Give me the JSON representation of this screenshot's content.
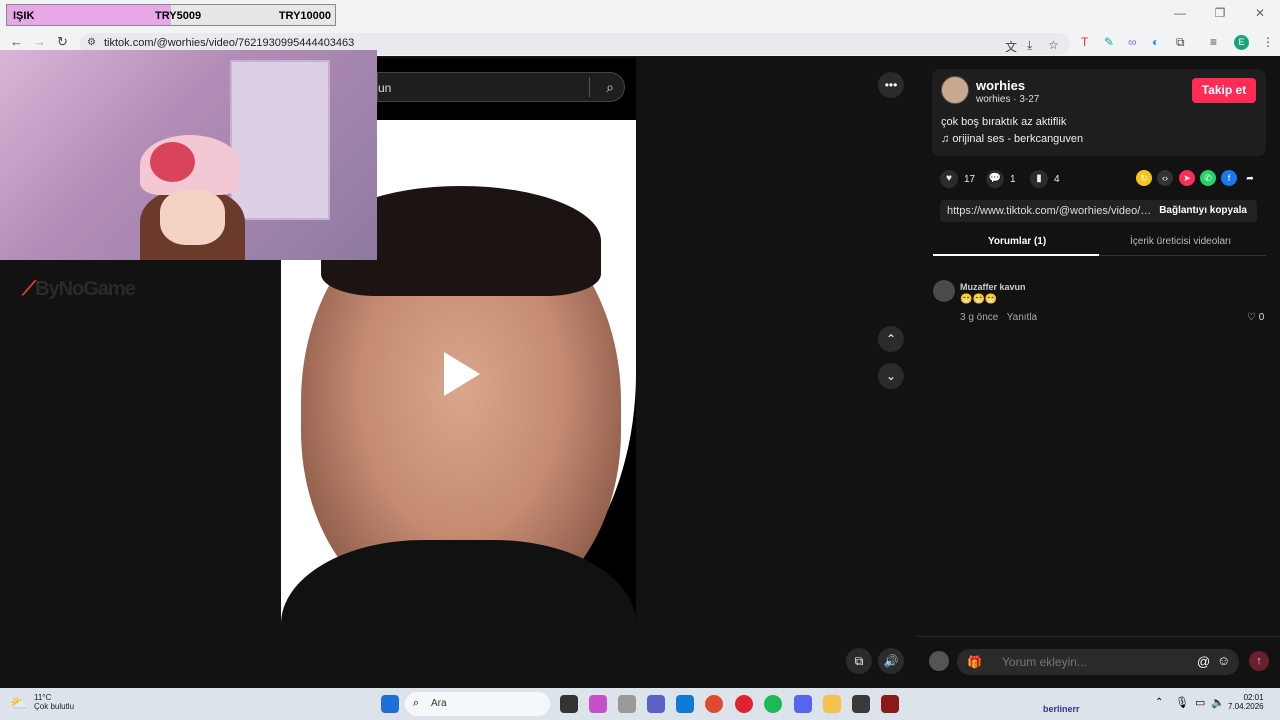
{
  "overlay": {
    "donation_name": "IŞIK",
    "donation_current": "TRY5009",
    "donation_goal": "TRY10000",
    "donation_progress_pct": 50.09
  },
  "browser": {
    "url": "tiktok.com/@worhies/video/7621930995444403463",
    "profile_initial": "E"
  },
  "stream_logo": "ByNoGame",
  "video": {
    "search_text": "un"
  },
  "post": {
    "username": "worhies",
    "subtitle": "worhies · 3-27",
    "follow_label": "Takip et",
    "description": "çok boş bıraktık az aktiflik",
    "music": "orijinal ses - berkcanguven",
    "likes": "17",
    "comments": "1",
    "saves": "4",
    "link": "https://www.tiktok.com/@worhies/video/7621...",
    "copy_label": "Bağlantıyı kopyala"
  },
  "tabs": {
    "comments": "Yorumlar (1)",
    "creator_videos": "İçerik üreticisi videoları"
  },
  "comment": {
    "author": "Muzaffer kavun",
    "text": "😁😁😁",
    "time": "3 g önce",
    "reply": "Yanıtla",
    "likes": "0"
  },
  "comment_input": {
    "placeholder": "Yorum ekleyin..."
  },
  "taskbar": {
    "temp": "11°C",
    "weather": "Çok bulutlu",
    "search": "Ara",
    "time": "02:01",
    "date": "7.04.2026",
    "notice_user": "berlinerr"
  }
}
